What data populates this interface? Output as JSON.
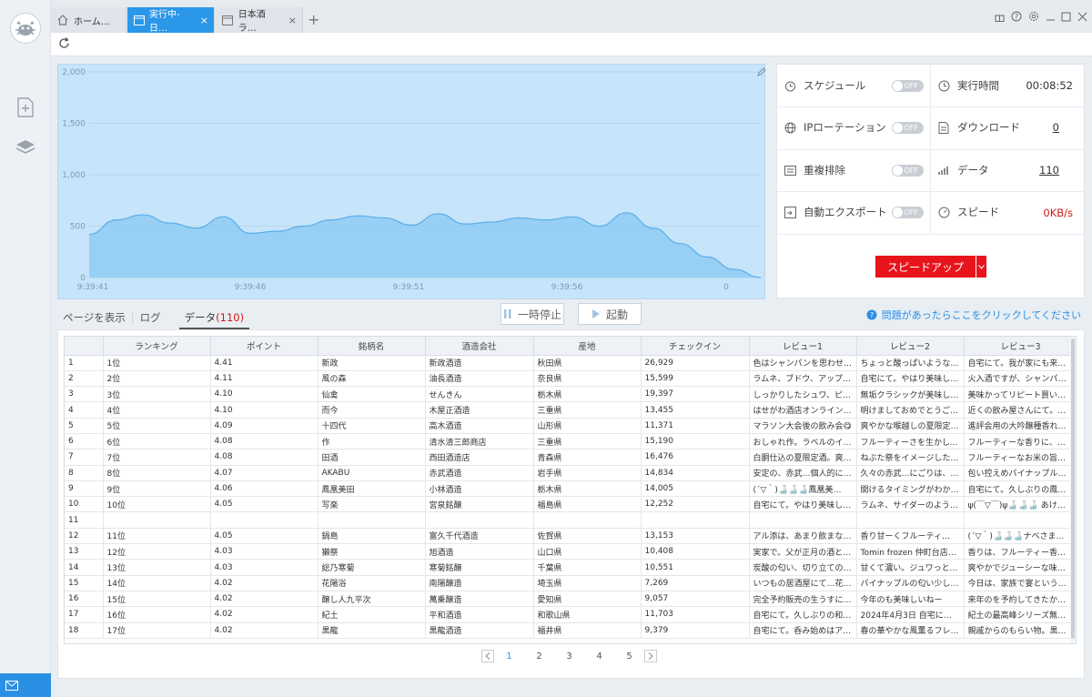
{
  "tabs": [
    {
      "label": "ホーム…",
      "icon": "home-icon"
    },
    {
      "label": "実行中-日…",
      "icon": "window-icon",
      "close": "×"
    },
    {
      "label": "日本酒ラ…",
      "icon": "window-icon",
      "close": "×"
    }
  ],
  "tab_add": "+",
  "window_controls": [
    "gift-icon",
    "help-icon",
    "settings-icon",
    "minimize-icon",
    "maximize-icon",
    "close-icon"
  ],
  "chart_data": {
    "type": "area",
    "x_ticks": [
      "9:39:41",
      "9:39:46",
      "9:39:51",
      "9:39:56",
      "0"
    ],
    "y_ticks": [
      "2,000",
      "1,500",
      "1,000",
      "500",
      "0"
    ],
    "ylim": [
      0,
      2000
    ],
    "x": [
      0,
      4,
      8,
      12,
      16,
      20,
      24,
      28,
      32,
      36,
      40,
      44,
      48,
      52,
      56,
      60,
      64,
      68,
      72,
      76,
      80,
      84,
      88,
      92,
      96,
      100
    ],
    "values": [
      420,
      560,
      610,
      530,
      480,
      590,
      430,
      450,
      500,
      560,
      600,
      580,
      510,
      620,
      520,
      540,
      580,
      560,
      590,
      500,
      630,
      480,
      330,
      200,
      80,
      0
    ],
    "grid": true,
    "colors": {
      "fill": "#8ecbf3",
      "line": "#5aaee8",
      "background": "#c6e4fa"
    }
  },
  "stats": {
    "schedule": {
      "label": "スケジュール",
      "toggle": "OFF"
    },
    "ip_rotation": {
      "label": "IPローテーション",
      "toggle": "OFF"
    },
    "dedupe": {
      "label": "重複排除",
      "toggle": "OFF"
    },
    "auto_export": {
      "label": "自動エクスポート",
      "toggle": "OFF"
    },
    "run_time": {
      "label": "実行時間",
      "value": "00:08:52"
    },
    "download": {
      "label": "ダウンロード",
      "value": "0"
    },
    "data": {
      "label": "データ",
      "value": "110"
    },
    "speed": {
      "label": "スピード",
      "value": "0KB/s"
    },
    "speedup_label": "スピードアップ"
  },
  "subtabs": {
    "page": "ページを表示",
    "log": "ログ",
    "data": "データ",
    "data_count": "(110)"
  },
  "controls": {
    "pause": "一時停止",
    "start": "起動"
  },
  "help_text": "問題があったらここをクリックしてください",
  "table": {
    "columns": [
      "",
      "ランキング",
      "ポイント",
      "銘柄名",
      "酒造会社",
      "産地",
      "チェックイン",
      "レビュー1",
      "レビュー2",
      "レビュー3"
    ],
    "rows": [
      [
        "1",
        "1位",
        "4.41",
        "新政",
        "新政酒造",
        "秋田県",
        "26,929",
        "色はシャンパンを思わせる…",
        "ちょっと酸っぱいような旬…",
        "自宅にて。我が家にも来ま…"
      ],
      [
        "2",
        "2位",
        "4.11",
        "風の森",
        "油長酒造",
        "奈良県",
        "15,599",
        "ラムネ、ブドウ、アップル…",
        "自宅にて。やはり美味しい…",
        "火入酒ですが、シャンパン…"
      ],
      [
        "3",
        "3位",
        "4.10",
        "仙禽",
        "せんきん",
        "栃木県",
        "19,397",
        "しっかりしたシュワ、ピチ…",
        "無垢クラシックが美味しい…",
        "美味かってリピート買い！…"
      ],
      [
        "4",
        "4位",
        "4.10",
        "而今",
        "木屋正酒造",
        "三重県",
        "13,455",
        "はせがわ酒店オンラインで…",
        "明けましておめでとうござ…",
        "近くの飲み屋さんにて。本…"
      ],
      [
        "5",
        "5位",
        "4.09",
        "十四代",
        "高木酒造",
        "山形県",
        "11,371",
        "マラソン大会後の飲み会😋",
        "爽やかな喉越しの夏限定酒…",
        "進評会用の大吟醸種香れ酒…"
      ],
      [
        "6",
        "6位",
        "4.08",
        "作",
        "清水清三郎商店",
        "三重県",
        "15,190",
        "おしゃれ作。ラベルのイメ…",
        "フルーティーさを生かしつ…",
        "フルーティーな香りに、透…"
      ],
      [
        "7",
        "7位",
        "4.08",
        "田酒",
        "西田酒造店",
        "青森県",
        "16,476",
        "白胴仕込の夏限定酒。爽や…",
        "ねぶた祭をイメージした、…",
        "フルーティーなお米の旨み…"
      ],
      [
        "8",
        "8位",
        "4.07",
        "AKABU",
        "赤武酒造",
        "岩手県",
        "14,834",
        "安定の、赤武…個人的には…",
        "久々の赤武…にごりは、あ…",
        "包い控えめパイナップルを…"
      ],
      [
        "9",
        "9位",
        "4.06",
        "鳳凰美田",
        "小林酒造",
        "栃木県",
        "14,005",
        "(´▽｀)🍶🍶🍶鳳凰美…",
        "開けるタイミングがわから…",
        "自宅にて。久しぶりの鳳凰…"
      ],
      [
        "10",
        "10位",
        "4.05",
        "写楽",
        "宮泉銘醸",
        "福島県",
        "12,252",
        "自宅にて。やはり美味しい…",
        "ラムネ、サイダーのような…",
        "ψ(￣▽￣)ψ🍶🍶🍶 あけ…"
      ],
      [
        "11",
        "",
        "",
        "",
        "",
        "",
        "",
        "",
        "",
        ""
      ],
      [
        "12",
        "11位",
        "4.05",
        "鍋島",
        "富久千代酒造",
        "佐賀県",
        "13,153",
        "アル添は、あまり飲まない…",
        "香り甘ーくフルーティ🍶香み…",
        "(´▽｀)🍶🍶🍶ナベさま…"
      ],
      [
        "13",
        "12位",
        "4.03",
        "獺祭",
        "旭酒造",
        "山口県",
        "10,408",
        "実家で。父が正月の酒とし…",
        "Tomin frozen 仲町台店で象…",
        "香りは、フルーティー香み…"
      ],
      [
        "14",
        "13位",
        "4.03",
        "総乃寒菊",
        "寒菊銘醸",
        "千葉県",
        "10,551",
        "炭酸の匂い、切り立てのリ…",
        "甘くて濃い。ジュワっとく…",
        "爽やかでジューシーな味わ…"
      ],
      [
        "15",
        "14位",
        "4.02",
        "花陽浴",
        "南陽醸造",
        "埼玉県",
        "7,269",
        "いつもの居酒屋にて…花陽…",
        "パイナップルの匂い少し飲…",
        "今日は、家族で宴というこ…"
      ],
      [
        "16",
        "15位",
        "4.02",
        "醸し人九平次",
        "萬乗醸造",
        "愛知県",
        "9,057",
        "完全予約販売の生うすにご…",
        "今年のも美味しいねー",
        "来年のを予約してきたから…"
      ],
      [
        "17",
        "16位",
        "4.02",
        "紀土",
        "平和酒造",
        "和歌山県",
        "11,703",
        "自宅にて。久しぶりの和歌…",
        "2024年4月3日 自宅にて晩酌…",
        "紀土の最高峰シリーズ無量…"
      ],
      [
        "18",
        "17位",
        "4.02",
        "黒龍",
        "黒龍酒造",
        "福井県",
        "9,379",
        "自宅にて。呑み始めはアル…",
        "春の華やかな風薫るフレッ…",
        "親戚からのもらい物。黒龍…"
      ]
    ]
  },
  "pager": {
    "pages": [
      "1",
      "2",
      "3",
      "4",
      "5"
    ],
    "current": "1"
  }
}
